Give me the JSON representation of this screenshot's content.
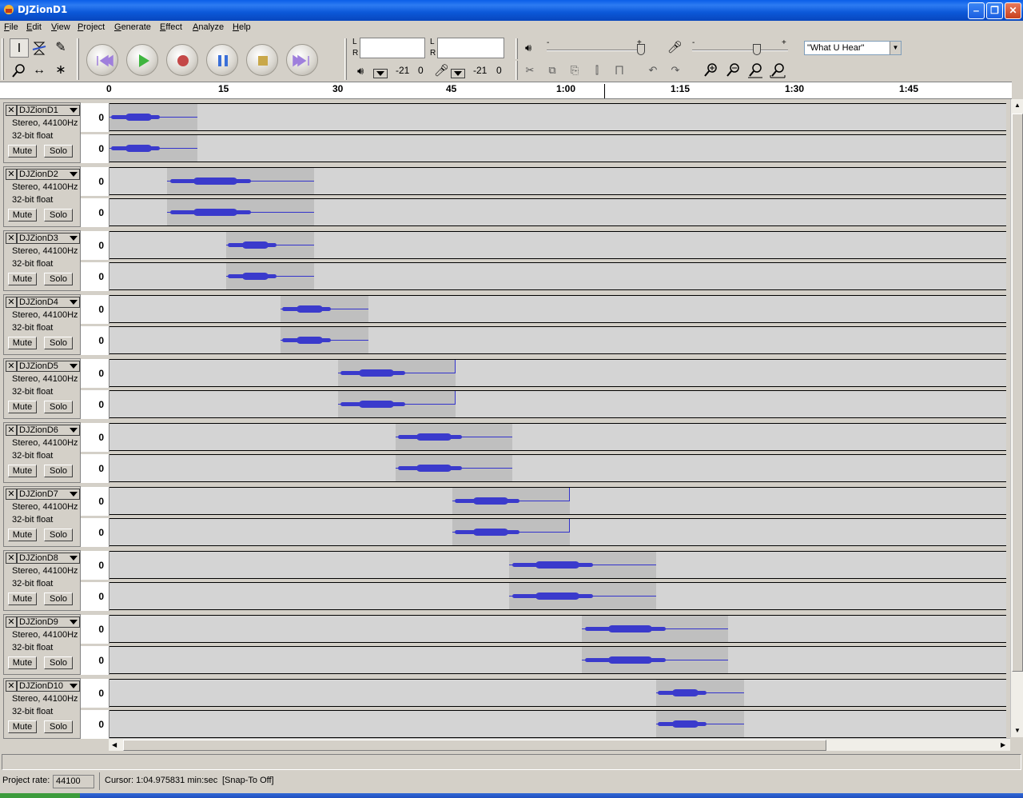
{
  "window": {
    "title": "DJZionD1"
  },
  "menu": [
    "File",
    "Edit",
    "View",
    "Project",
    "Generate",
    "Effect",
    "Analyze",
    "Help"
  ],
  "meters": {
    "playback": {
      "L": "L",
      "R": "R",
      "scale_left": "-21",
      "scale_right": "0"
    },
    "record": {
      "L": "L",
      "R": "R",
      "scale_left": "-21",
      "scale_right": "0"
    }
  },
  "mixer": {
    "output_minus": "-",
    "output_plus": "+",
    "input_minus": "-",
    "input_plus": "+",
    "input_source": "\"What U Hear\""
  },
  "ruler": {
    "ticks": [
      "0",
      "15",
      "30",
      "45",
      "1:00",
      "1:15",
      "1:30",
      "1:45"
    ]
  },
  "tracks": [
    {
      "name": "DJZionD1",
      "format": "Stereo, 44100Hz",
      "bits": "32-bit float",
      "mute": "Mute",
      "solo": "Solo",
      "vscale": "0"
    },
    {
      "name": "DJZionD2",
      "format": "Stereo, 44100Hz",
      "bits": "32-bit float",
      "mute": "Mute",
      "solo": "Solo",
      "vscale": "0"
    },
    {
      "name": "DJZionD3",
      "format": "Stereo, 44100Hz",
      "bits": "32-bit float",
      "mute": "Mute",
      "solo": "Solo",
      "vscale": "0"
    },
    {
      "name": "DJZionD4",
      "format": "Stereo, 44100Hz",
      "bits": "32-bit float",
      "mute": "Mute",
      "solo": "Solo",
      "vscale": "0"
    },
    {
      "name": "DJZionD5",
      "format": "Stereo, 44100Hz",
      "bits": "32-bit float",
      "mute": "Mute",
      "solo": "Solo",
      "vscale": "0"
    },
    {
      "name": "DJZionD6",
      "format": "Stereo, 44100Hz",
      "bits": "32-bit float",
      "mute": "Mute",
      "solo": "Solo",
      "vscale": "0"
    },
    {
      "name": "DJZionD7",
      "format": "Stereo, 44100Hz",
      "bits": "32-bit float",
      "mute": "Mute",
      "solo": "Solo",
      "vscale": "0"
    },
    {
      "name": "DJZionD8",
      "format": "Stereo, 44100Hz",
      "bits": "32-bit float",
      "mute": "Mute",
      "solo": "Solo",
      "vscale": "0"
    },
    {
      "name": "DJZionD9",
      "format": "Stereo, 44100Hz",
      "bits": "32-bit float",
      "mute": "Mute",
      "solo": "Solo",
      "vscale": "0"
    },
    {
      "name": "DJZionD10",
      "format": "Stereo, 44100Hz",
      "bits": "32-bit float",
      "mute": "Mute",
      "solo": "Solo",
      "vscale": "0"
    }
  ],
  "status": {
    "rate_label": "Project rate:",
    "rate_value": "44100",
    "cursor": "Cursor: 1:04.975831 min:sec",
    "snap": "[Snap-To Off]"
  }
}
